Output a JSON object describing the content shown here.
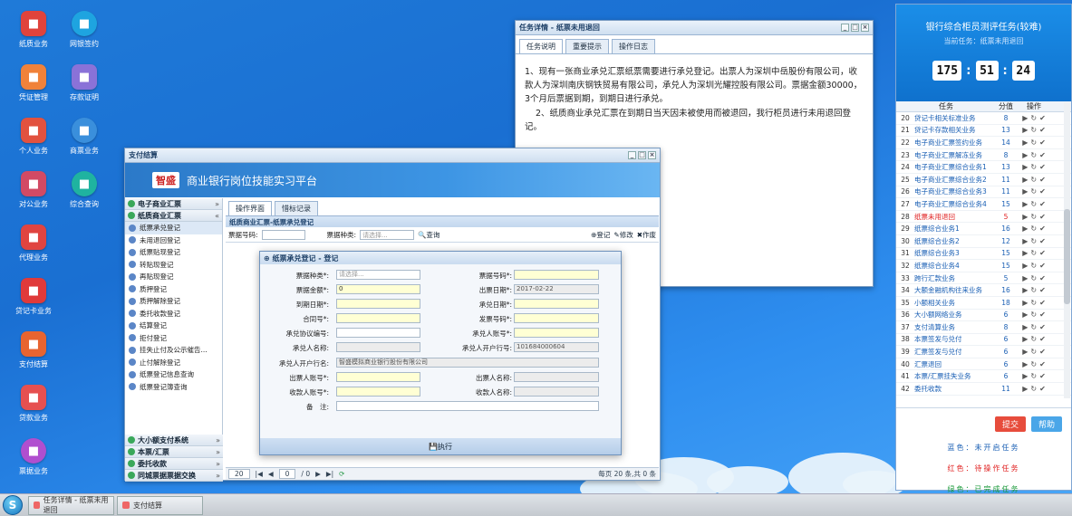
{
  "desktop_icons": [
    {
      "label": "纸质业务",
      "color": "#e0433b"
    },
    {
      "label": "网银签约",
      "color": "#1ea4e0"
    },
    {
      "label": "凭证管理",
      "color": "#f0823a"
    },
    {
      "label": "存款证明",
      "color": "#8a72d8"
    },
    {
      "label": "个人业务",
      "color": "#e2523f"
    },
    {
      "label": "商票业务",
      "color": "#3a8fdc"
    },
    {
      "label": "对公业务",
      "color": "#d24a64"
    },
    {
      "label": "综合查询",
      "color": "#1fb3a0"
    },
    {
      "label": "代理业务",
      "color": "#e04440"
    },
    {
      "label": "贷记卡业务",
      "color": "#e03a3a"
    },
    {
      "label": "支付结算",
      "color": "#e86430"
    },
    {
      "label": "贷款业务",
      "color": "#e65050"
    },
    {
      "label": "票据业务",
      "color": "#b04fcf"
    }
  ],
  "taskbar": {
    "start": "S",
    "items": [
      "任务详情 - 纸票未用退回",
      "支付结算"
    ]
  },
  "task_window": {
    "title": "任务详情 - 纸票未用退回",
    "tabs": [
      "任务说明",
      "重要提示",
      "操作日志"
    ],
    "para1": "1、现有一张商业承兑汇票纸票需要进行承兑登记。出票人为深圳中岳股份有限公司，收款人为深圳南庆钢铁贸易有限公司，承兑人为深圳光耀控股有限公司。票据金额30000，3个月后票据到期，到期日进行承兑。",
    "para2": "2、纸质商业承兑汇票在到期日当天因未被使用而被退回，我行柜员进行未用退回登记。"
  },
  "right_panel": {
    "title": "银行综合柜员测评任务(较难)",
    "subtitle": "当前任务：纸票未用退回",
    "timer": [
      "175",
      "51",
      "24"
    ],
    "col_task": "任务",
    "col_score": "分值",
    "col_ops": "操作",
    "tasks": [
      {
        "n": "20",
        "name": "贷记卡相关标准业务",
        "s": "8"
      },
      {
        "n": "21",
        "name": "贷记卡存款相关业务",
        "s": "13"
      },
      {
        "n": "22",
        "name": "电子商业汇票签约业务",
        "s": "14"
      },
      {
        "n": "23",
        "name": "电子商业汇票解冻业务",
        "s": "8"
      },
      {
        "n": "24",
        "name": "电子商业汇票综合业务1",
        "s": "13"
      },
      {
        "n": "25",
        "name": "电子商业汇票综合业务2",
        "s": "11"
      },
      {
        "n": "26",
        "name": "电子商业汇票综合业务3",
        "s": "11"
      },
      {
        "n": "27",
        "name": "电子商业汇票综合业务4",
        "s": "15"
      },
      {
        "n": "28",
        "name": "纸票未用退回",
        "s": "5",
        "red": true
      },
      {
        "n": "29",
        "name": "纸票综合业务1",
        "s": "16"
      },
      {
        "n": "30",
        "name": "纸票综合业务2",
        "s": "12"
      },
      {
        "n": "31",
        "name": "纸票综合业务3",
        "s": "15"
      },
      {
        "n": "32",
        "name": "纸票综合业务4",
        "s": "15"
      },
      {
        "n": "33",
        "name": "跨行汇款业务",
        "s": "5"
      },
      {
        "n": "34",
        "name": "大额金融机构往来业务",
        "s": "16"
      },
      {
        "n": "35",
        "name": "小额相关业务",
        "s": "18"
      },
      {
        "n": "36",
        "name": "大小额网络业务",
        "s": "6"
      },
      {
        "n": "37",
        "name": "支付清算业务",
        "s": "8"
      },
      {
        "n": "38",
        "name": "本票签发与兑付",
        "s": "6"
      },
      {
        "n": "39",
        "name": "汇票签发与兑付",
        "s": "6"
      },
      {
        "n": "40",
        "name": "汇票退回",
        "s": "6"
      },
      {
        "n": "41",
        "name": "本票/汇票挂失业务",
        "s": "6"
      },
      {
        "n": "42",
        "name": "委托收款",
        "s": "11"
      }
    ],
    "submit": "提交",
    "help": "帮助",
    "legend": [
      {
        "text": "蓝色：未开启任务",
        "color": "#1a5fb4"
      },
      {
        "text": "红色：待操作任务",
        "color": "#e02020"
      },
      {
        "text": "绿色：已完成任务",
        "color": "#1a9a3a"
      }
    ]
  },
  "pay_window": {
    "title": "支付结算",
    "logo": "智盛",
    "platform": "商业银行岗位技能实习平台",
    "nav_groups": [
      "电子商业汇票",
      "纸质商业汇票"
    ],
    "nav_items": [
      "纸票承兑登记",
      "未用退回登记",
      "纸票贴现登记",
      "转贴现登记",
      "再贴现登记",
      "质押登记",
      "质押解除登记",
      "委托收款登记",
      "结算登记",
      "拒付登记",
      "挂失止付及公示催告...",
      "止付解除登记",
      "纸票登记信息查询",
      "纸票登记簿查询"
    ],
    "nav_bottom": [
      "大小额支付系统",
      "本票/汇票",
      "委托收款",
      "同城票据票据交换"
    ],
    "tabs": [
      "操作界面",
      "惜标记录"
    ],
    "grid_title": "纸质商业汇票-纸票承兑登记",
    "q_label1": "票据号码:",
    "q_label2": "票据种类:",
    "q_select": "请选择...",
    "q_search": "查询",
    "act_reg": "登记",
    "act_edit": "修改",
    "act_cancel": "作废",
    "pager_size": "20",
    "pager_page": "0",
    "pager_total": "/ 0",
    "pager_info": "每页 20 条,共 0 条"
  },
  "modal": {
    "title": "纸票承兑登记 - 登记",
    "exec": "执行",
    "fields": {
      "l_type": "票据种类*:",
      "v_type": "请选择...",
      "l_no": "票据号码*:",
      "l_amt": "票据金额*:",
      "v_amt": "0",
      "l_issue": "出票日期*:",
      "v_issue": "2017-02-22",
      "l_due": "到期日期*:",
      "l_acc": "承兑日期*:",
      "l_contract": "合同号*:",
      "l_invoice": "发票号码*:",
      "l_agree": "承兑协议编号:",
      "l_acceptor_acct": "承兑人账号*:",
      "l_acceptor_name": "承兑人名称:",
      "l_acceptor_bank_no": "承兑人开户行号:",
      "v_acceptor_bank_no": "101684000604",
      "l_acceptor_bank": "承兑人开户行名:",
      "v_acceptor_bank": "智盛模拟商业银行股份有限公司",
      "l_drawer_acct": "出票人账号*:",
      "l_drawer_name": "出票人名称:",
      "l_payee_acct": "收款人账号*:",
      "l_payee_name": "收款人名称:",
      "l_note": "备　注:"
    }
  }
}
